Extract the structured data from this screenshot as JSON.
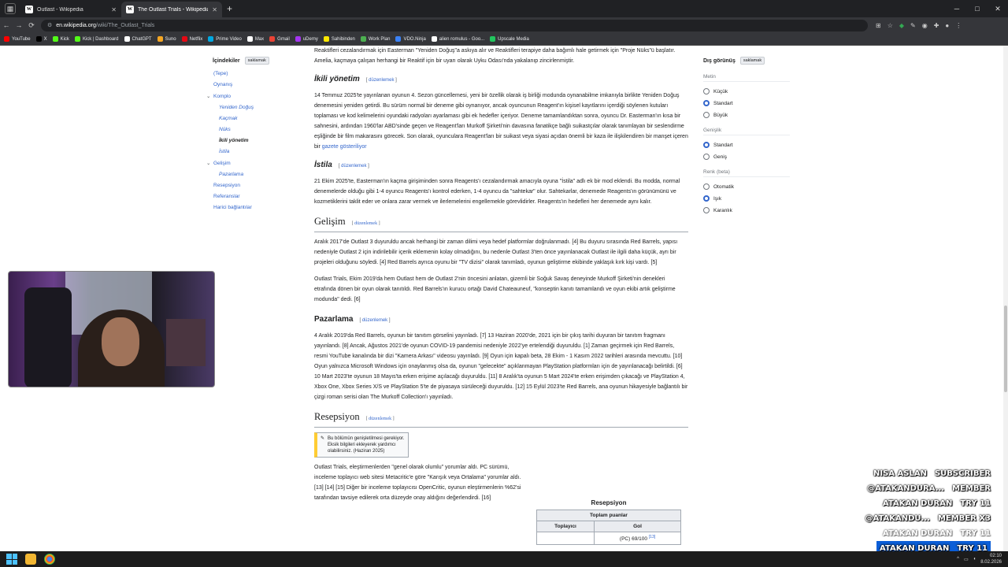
{
  "browser": {
    "tabs": [
      {
        "label": "Outlast - Wikipedia",
        "active": false
      },
      {
        "label": "The Outlast Trials - Wikipedia",
        "active": true
      }
    ],
    "url_host": "en.wikipedia.org",
    "url_path": "/wiki/The_Outlast_Trials",
    "bookmarks": [
      {
        "label": "YouTube",
        "color": "#ff0000"
      },
      {
        "label": "X",
        "color": "#000000"
      },
      {
        "label": "Kick",
        "color": "#53fc18"
      },
      {
        "label": "Kick | Dashboard",
        "color": "#53fc18"
      },
      {
        "label": "ChatGPT",
        "color": "#ffffff"
      },
      {
        "label": "Suno",
        "color": "#f5a623"
      },
      {
        "label": "Netflix",
        "color": "#e50914"
      },
      {
        "label": "Prime Video",
        "color": "#00a8e1"
      },
      {
        "label": "Max",
        "color": "#ffffff"
      },
      {
        "label": "Gmail",
        "color": "#ea4335"
      },
      {
        "label": "uDemy",
        "color": "#a435f0"
      },
      {
        "label": "Sahibinden",
        "color": "#ffe800"
      },
      {
        "label": "Work Plan",
        "color": "#4caf50"
      },
      {
        "label": "VDO.Ninja",
        "color": "#3b82f6"
      },
      {
        "label": "alien romulus - Goo...",
        "color": "#ffffff"
      },
      {
        "label": "Upscale Media",
        "color": "#22c55e"
      }
    ]
  },
  "toc": {
    "title": "İçindekiler",
    "hide_label": "saklamak",
    "items": [
      {
        "label": "(Tepe)",
        "level": 1
      },
      {
        "label": "Oynanış",
        "level": 1
      },
      {
        "label": "Komplo",
        "level": 1,
        "expanded": true
      },
      {
        "label": "Yeniden Doğuş",
        "level": 2
      },
      {
        "label": "Kaçmak",
        "level": 2
      },
      {
        "label": "Nüks",
        "level": 2
      },
      {
        "label": "İkili yönetim",
        "level": 2,
        "current": true
      },
      {
        "label": "İstila",
        "level": 2
      },
      {
        "label": "Gelişim",
        "level": 1,
        "expanded": true
      },
      {
        "label": "Pazarlama",
        "level": 2
      },
      {
        "label": "Resepsiyon",
        "level": 1
      },
      {
        "label": "Referanslar",
        "level": 1
      },
      {
        "label": "Harici bağlantılar",
        "level": 1
      }
    ]
  },
  "article": {
    "top_text": "Reaktifleri cezalandırmak için Easterman \"Yeniden Doğuş\"a askıya alır ve Reaktifleri terapiye daha bağımlı hale getirmek için \"Proje Nüks\"ü başlatır. Amelia, kaçmaya çalışan herhangi bir Reaktif için bir uyarı olarak Uyku Odası'nda yakalanıp zincirlenmiştir.",
    "edit_label": "düzenlemek",
    "s_ikili_title": "İkili yönetim",
    "s_ikili_p1": "14 Temmuz 2025'te yayınlanan oyunun 4. Sezon güncellemesi, yeni bir özellik olarak iş birliği modunda oynanabilme imkanıyla birlikte Yeniden Doğuş denemesini yeniden getirdi. Bu sürüm normal bir deneme gibi oynanıyor, ancak oyuncunun Reagent'ın kişisel kayıtlarını içerdiği söylenen kutuları toplaması ve kod kelimelerini oyundaki radyoları ayarlaması gibi ek hedefler içeriyor. Deneme tamamlandıktan sonra, oyuncu Dr. Easterman'ın kısa bir sahnesini, ardından 1960'lar ABD'sinde geçen ve Reagent'ları Murkoff Şirketi'nin davasına fanatikçe bağlı suikastçılar olarak tanımlayan bir seslendirme eşliğinde bir film makarasını görecek. Son olarak, oyunculara Reagent'ları bir suikast veya siyasi açıdan önemli bir kaza ile ilişkilendiren bir manşet içeren bir",
    "s_ikili_link": "gazete gösteriliyor",
    "s_istila_title": "İstila",
    "s_istila_p1": "21 Ekim 2025'te, Easterman'ın kaçma girişiminden sonra Reagents'ı cezalandırmak amacıyla oyuna \"İstila\" adlı ek bir mod eklendi. Bu modda, normal denemelerde olduğu gibi 1-4 oyuncu Reagents'ı kontrol ederken, 1-4 oyuncu da \"sahtekar\" olur. Sahtekarlar, denemede Reagents'ın görünümünü ve kozmetiklerini taklit eder ve onlara zarar vermek ve ilerlemelerini engellemekle görevlidirler. Reagents'ın hedefleri her denemede aynı kalır.",
    "s_gelisim_title": "Gelişim",
    "s_gelisim_p1": "Aralık 2017'de Outlast 3 duyuruldu ancak herhangi bir zaman dilimi veya hedef platformlar doğrulanmadı. [4] Bu duyuru sırasında Red Barrels, yapısı nedeniyle Outlast 2 için indirilebilir içerik eklemenin kolay olmadığını, bu nedenle Outlast 3'ten önce yayınlanacak Outlast ile ilgili daha küçük, ayrı bir projeleri olduğunu söyledi. [4] Red Barrels ayrıca oyunu bir \"TV dizisi\" olarak tanımladı, oyunun geliştirme ekibinde yaklaşık kırk kişi vardı. [5]",
    "s_gelisim_p2": "Outlast Trials, Ekim 2019'da hem Outlast hem de Outlast 2'nin öncesini anlatan, gizemli bir Soğuk Savaş deneyinde Murkoff Şirketi'nin denekleri etrafında dönen bir oyun olarak tanıtıldı. Red Barrels'ın kurucu ortağı David Chateauneuf, \"konseptin kanıtı tamamlandı ve oyun ekibi artık geliştirme modunda\" dedi. [6]",
    "s_pazar_title": "Pazarlama",
    "s_pazar_p1": "4 Aralık 2019'da Red Barrels, oyunun bir tanıtım görselini yayınladı. [7] 13 Haziran 2020'de, 2021 için bir çıkış tarihi duyuran bir tanıtım fragmanı yayınlandı. [8] Ancak, Ağustos 2021'de oyunun COVID-19 pandemisi nedeniyle 2022'ye ertelendiği duyuruldu. [1] Zaman geçirmek için Red Barrels, resmi YouTube kanalında bir dizi \"Kamera Arkası\" videosu yayınladı. [9] Oyun için kapalı beta, 28 Ekim - 1 Kasım 2022 tarihleri arasında mevcuttu. [10] Oyun yalnızca Microsoft Windows için onaylanmış olsa da, oyunun \"gelecekte\" açıklanmayan PlayStation platformları için de yayınlanacağı belirtildi. [6] 10 Mart 2023'te oyunun 18 Mayıs'ta erken erişime açılacağı duyuruldu. [11] 8 Aralık'ta oyunun 5 Mart 2024'te erken erişimden çıkacağı ve PlayStation 4, Xbox One, Xbox Series X/S ve PlayStation 5'te de piyasaya sürüleceği duyuruldu. [12] 15 Eylül 2023'te Red Barrels, ana oyunun hikayesiyle bağlantılı bir çizgi roman serisi olan The Murkoff Collection'ı yayınladı.",
    "s_resep_title": "Resepsiyon",
    "ambox_text": "Bu bölümün genişletilmesi gerekiyor. Eksik bilgileri ekleyerek yardımcı olabilirsiniz. (Haziran 2025)",
    "s_resep_p1": "Outlast Trials, eleştirmenlerden \"genel olarak olumlu\" yorumlar aldı. PC sürümü, inceleme toplayıcı web sitesi Metacritic'e göre \"Karışık veya Ortalama\" yorumlar aldı. [13] [14] [15] Diğer bir inceleme toplayıcısı OpenCritic, oyunun eleştirmenlerin %62'si tarafından tavsiye edilerek orta düzeyde onay aldığını değerlendirdi. [16]"
  },
  "infobox": {
    "caption": "Resepsiyon",
    "header": "Toplam puanlar",
    "col1": "Toplayıcı",
    "col2": "Gol",
    "row1_score": "(PC) 69/100",
    "row1_ref": "[13]"
  },
  "appearance": {
    "title": "Dış görünüş",
    "hide_label": "saklamak",
    "groups": [
      {
        "label": "Metin",
        "options": [
          {
            "label": "Küçük",
            "on": false
          },
          {
            "label": "Standart",
            "on": true
          },
          {
            "label": "Büyük",
            "on": false
          }
        ]
      },
      {
        "label": "Genişlik",
        "options": [
          {
            "label": "Standart",
            "on": true
          },
          {
            "label": "Geniş",
            "on": false
          }
        ]
      },
      {
        "label": "Renk (beta)",
        "options": [
          {
            "label": "Otomatik",
            "on": false
          },
          {
            "label": "Işık",
            "on": true
          },
          {
            "label": "Karanlık",
            "on": false
          }
        ]
      }
    ]
  },
  "stream_overlay": [
    {
      "name": "NISA ASLAN",
      "tag": "SUBSCRIBER",
      "style": "normal"
    },
    {
      "name": "@ATAKANDURA...",
      "tag": "MEMBER",
      "style": "normal"
    },
    {
      "name": "ATAKAN DURAN",
      "tag": "TRY 11",
      "style": "normal"
    },
    {
      "name": "@ATAKANDU...",
      "tag": "MEMBER X3",
      "style": "normal"
    },
    {
      "name": "ATAKAN DURAN",
      "tag": "TRY 11",
      "style": "dim"
    },
    {
      "name": "ATAKAN DURAN",
      "tag": "TRY 11",
      "style": "highlight"
    }
  ],
  "taskbar": {
    "time": "02:10",
    "date": "8.02.2026"
  }
}
